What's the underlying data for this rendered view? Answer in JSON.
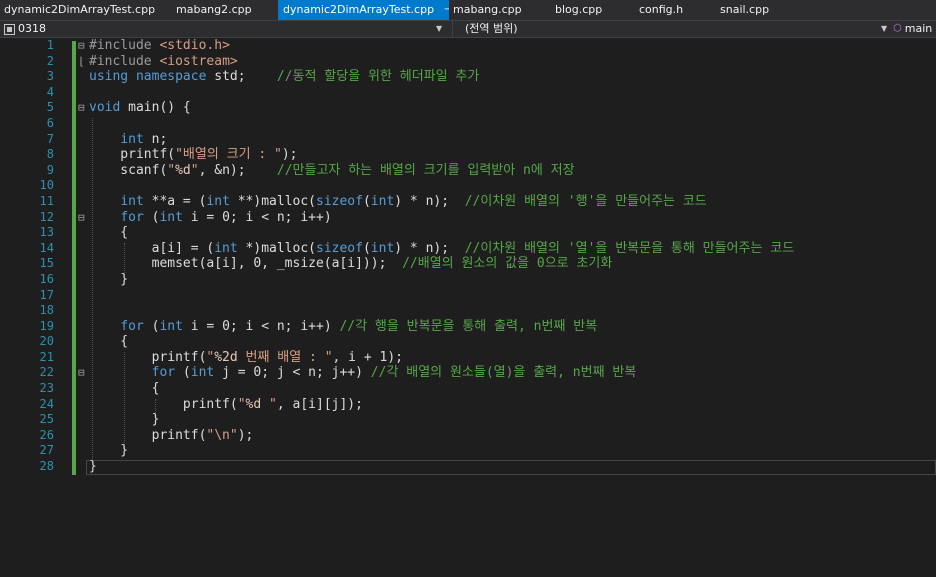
{
  "tabs": [
    {
      "label": "dynamic2DimArrayTest.cpp",
      "active": false
    },
    {
      "label": "mabang2.cpp",
      "active": false
    },
    {
      "label": "dynamic2DimArrayTest.cpp",
      "active": true
    },
    {
      "label": "mabang.cpp",
      "active": false
    },
    {
      "label": "blog.cpp",
      "active": false
    },
    {
      "label": "config.h",
      "active": false
    },
    {
      "label": "snail.cpp",
      "active": false
    }
  ],
  "navbar": {
    "project": "0318",
    "scope": "(전역 범위)",
    "member": "main"
  },
  "editor": {
    "line_numbers": [
      "1",
      "2",
      "3",
      "4",
      "5",
      "6",
      "7",
      "8",
      "9",
      "10",
      "11",
      "12",
      "13",
      "14",
      "15",
      "16",
      "17",
      "18",
      "19",
      "20",
      "21",
      "22",
      "23",
      "24",
      "25",
      "26",
      "27",
      "28"
    ],
    "lines": [
      [
        {
          "t": "#include ",
          "c": "pp"
        },
        {
          "t": "<stdio.h>",
          "c": "inc"
        }
      ],
      [
        {
          "t": "#include ",
          "c": "pp"
        },
        {
          "t": "<iostream>",
          "c": "inc"
        }
      ],
      [
        {
          "t": "using",
          "c": "kw"
        },
        {
          "t": " "
        },
        {
          "t": "namespace",
          "c": "kw"
        },
        {
          "t": " std;    "
        },
        {
          "t": "//동적 할당을 위한 헤더파일 추가",
          "c": "cm"
        }
      ],
      [],
      [
        {
          "t": "void",
          "c": "kw"
        },
        {
          "t": " main() {"
        }
      ],
      [],
      [
        {
          "t": "    "
        },
        {
          "t": "int",
          "c": "kw"
        },
        {
          "t": " n;"
        }
      ],
      [
        {
          "t": "    printf("
        },
        {
          "t": "\"배열의 크기 : \"",
          "c": "str"
        },
        {
          "t": ");"
        }
      ],
      [
        {
          "t": "    scanf("
        },
        {
          "t": "\"",
          "c": "str"
        },
        {
          "t": "%d",
          "c": "fmt"
        },
        {
          "t": "\"",
          "c": "str"
        },
        {
          "t": ", &n);    "
        },
        {
          "t": "//만들고자 하는 배열의 크기를 입력받아 n에 저장",
          "c": "cm"
        }
      ],
      [],
      [
        {
          "t": "    "
        },
        {
          "t": "int",
          "c": "kw"
        },
        {
          "t": " **a = ("
        },
        {
          "t": "int",
          "c": "kw"
        },
        {
          "t": " **)malloc("
        },
        {
          "t": "sizeof",
          "c": "kw"
        },
        {
          "t": "("
        },
        {
          "t": "int",
          "c": "kw"
        },
        {
          "t": ") * n);  "
        },
        {
          "t": "//이차원 배열의 '행'을 만들어주는 코드",
          "c": "cm"
        }
      ],
      [
        {
          "t": "    "
        },
        {
          "t": "for",
          "c": "kw"
        },
        {
          "t": " ("
        },
        {
          "t": "int",
          "c": "kw"
        },
        {
          "t": " i = 0; i < n; i++)"
        }
      ],
      [
        {
          "t": "    {"
        }
      ],
      [
        {
          "t": "        a[i] = ("
        },
        {
          "t": "int",
          "c": "kw"
        },
        {
          "t": " *)malloc("
        },
        {
          "t": "sizeof",
          "c": "kw"
        },
        {
          "t": "("
        },
        {
          "t": "int",
          "c": "kw"
        },
        {
          "t": ") * n);  "
        },
        {
          "t": "//이차원 배열의 '열'을 반복문을 통해 만들어주는 코드",
          "c": "cm"
        }
      ],
      [
        {
          "t": "        memset(a[i], 0, _msize(a[i]));  "
        },
        {
          "t": "//배열의 원소의 값을 0으로 초기화",
          "c": "cm"
        }
      ],
      [
        {
          "t": "    }"
        }
      ],
      [],
      [],
      [
        {
          "t": "    "
        },
        {
          "t": "for",
          "c": "kw"
        },
        {
          "t": " ("
        },
        {
          "t": "int",
          "c": "kw"
        },
        {
          "t": " i = 0; i < n; i++) "
        },
        {
          "t": "//각 행을 반복문을 통해 출력, n번째 반복",
          "c": "cm"
        }
      ],
      [
        {
          "t": "    {"
        }
      ],
      [
        {
          "t": "        printf("
        },
        {
          "t": "\"",
          "c": "str"
        },
        {
          "t": "%2d",
          "c": "fmt"
        },
        {
          "t": " 번째 배열 : \"",
          "c": "str"
        },
        {
          "t": ", i + 1);"
        }
      ],
      [
        {
          "t": "        "
        },
        {
          "t": "for",
          "c": "kw"
        },
        {
          "t": " ("
        },
        {
          "t": "int",
          "c": "kw"
        },
        {
          "t": " j = 0; j < n; j++) "
        },
        {
          "t": "//각 배열의 원소들(열)을 출력, n번째 반복",
          "c": "cm"
        }
      ],
      [
        {
          "t": "        {"
        }
      ],
      [
        {
          "t": "            printf("
        },
        {
          "t": "\"",
          "c": "str"
        },
        {
          "t": "%d",
          "c": "fmt"
        },
        {
          "t": " \"",
          "c": "str"
        },
        {
          "t": ", a[i][j]);"
        }
      ],
      [
        {
          "t": "        }"
        }
      ],
      [
        {
          "t": "        printf("
        },
        {
          "t": "\"\\n\"",
          "c": "str"
        },
        {
          "t": ");"
        }
      ],
      [
        {
          "t": "    }"
        }
      ],
      [
        {
          "t": "}"
        }
      ]
    ],
    "folds": {
      "0": "⊟",
      "1": "⌊",
      "4": "⊟",
      "11": "⊟",
      "21": "⊟"
    }
  },
  "colors": {
    "background": "#1e1e1e",
    "tab_active": "#007acc",
    "keyword": "#569cd6",
    "string": "#d69d85",
    "comment": "#57a64a",
    "line_number": "#2b91af"
  }
}
